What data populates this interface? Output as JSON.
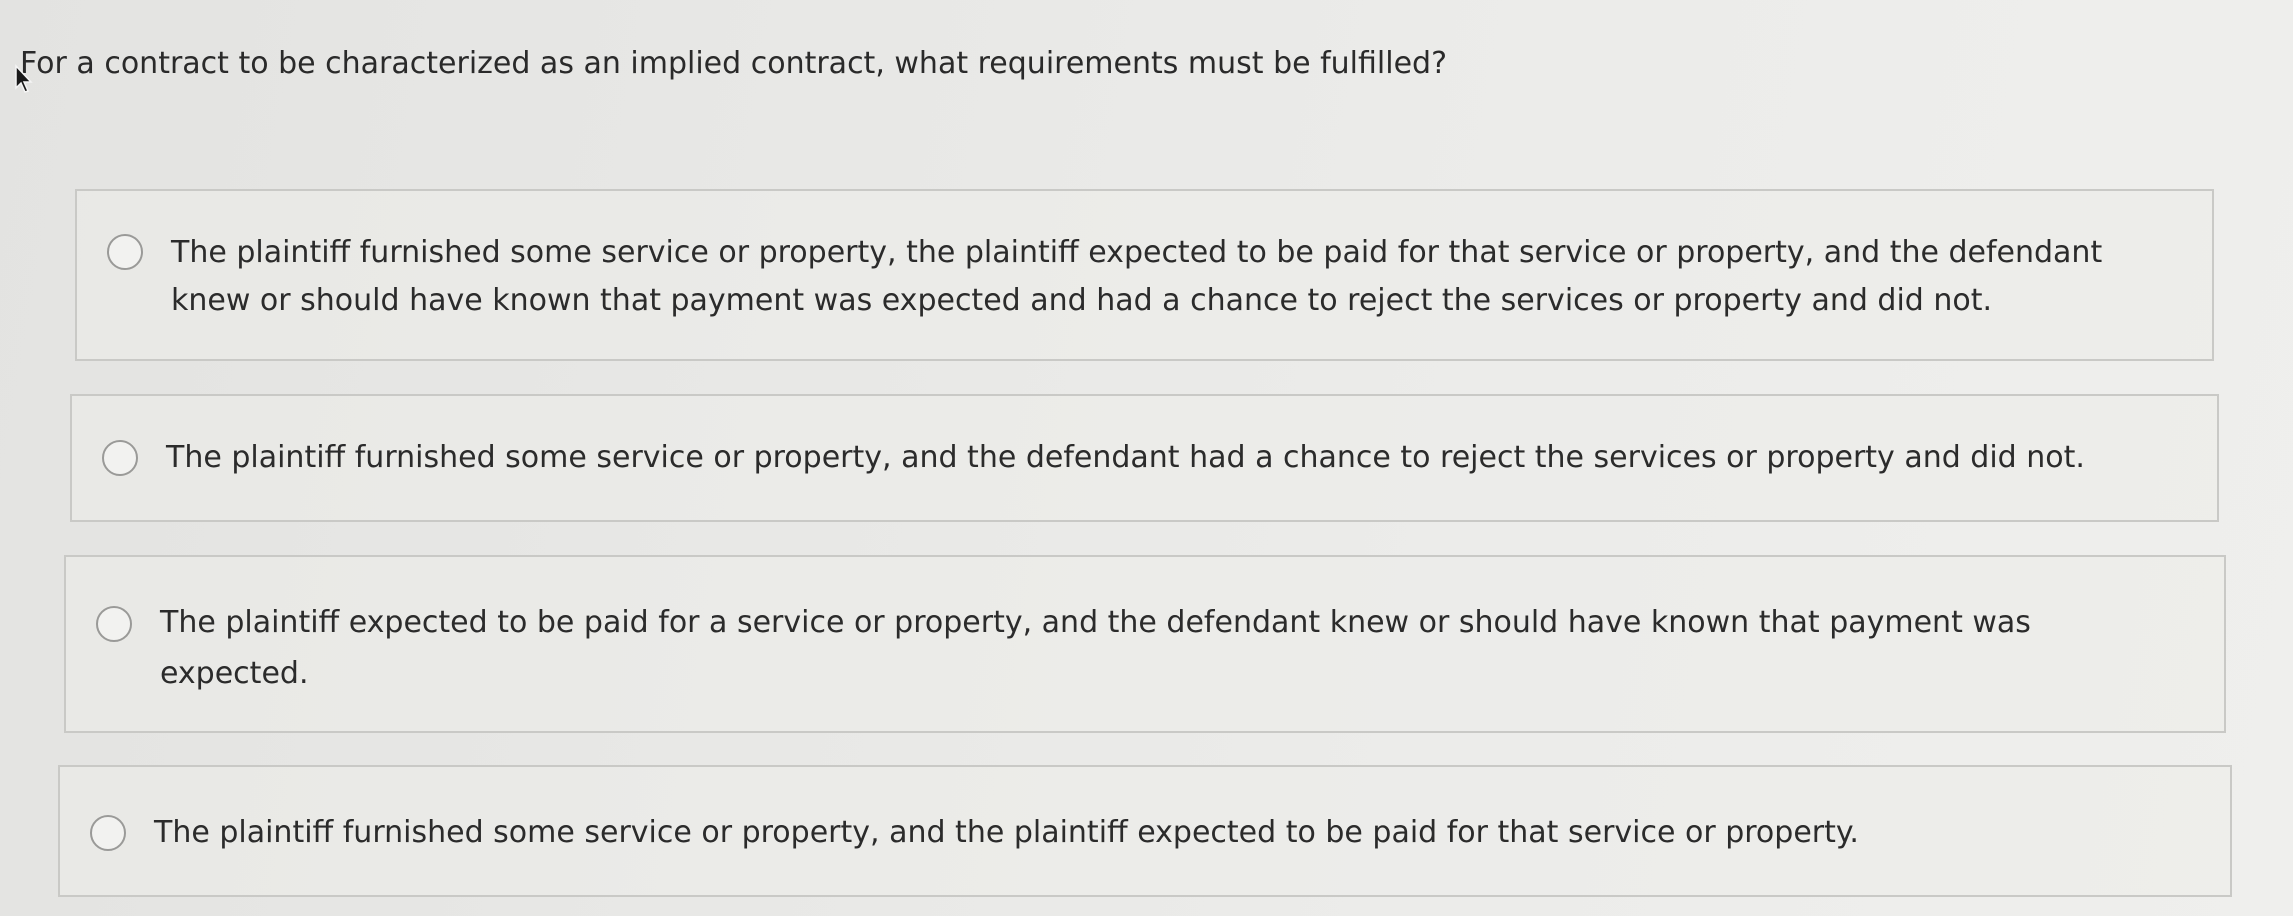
{
  "question": {
    "text": "For a contract to be characterized as an implied contract, what requirements must be fulfilled?"
  },
  "options": [
    {
      "text": "The plaintiff furnished some service or property, the plaintiff expected to be paid for that service or property, and the defendant knew or should have known that payment was expected and had a chance to reject the services or property and did not.",
      "selected": false
    },
    {
      "text": "The plaintiff furnished some service or property, and the defendant had a chance to reject the services or property and did not.",
      "selected": false
    },
    {
      "text": "The plaintiff expected to be paid for a service or property, and the defendant knew or should have known that payment was expected.",
      "selected": false
    },
    {
      "text": "The plaintiff furnished some service or property, and the plaintiff expected to be paid for that service or property.",
      "selected": false
    }
  ]
}
